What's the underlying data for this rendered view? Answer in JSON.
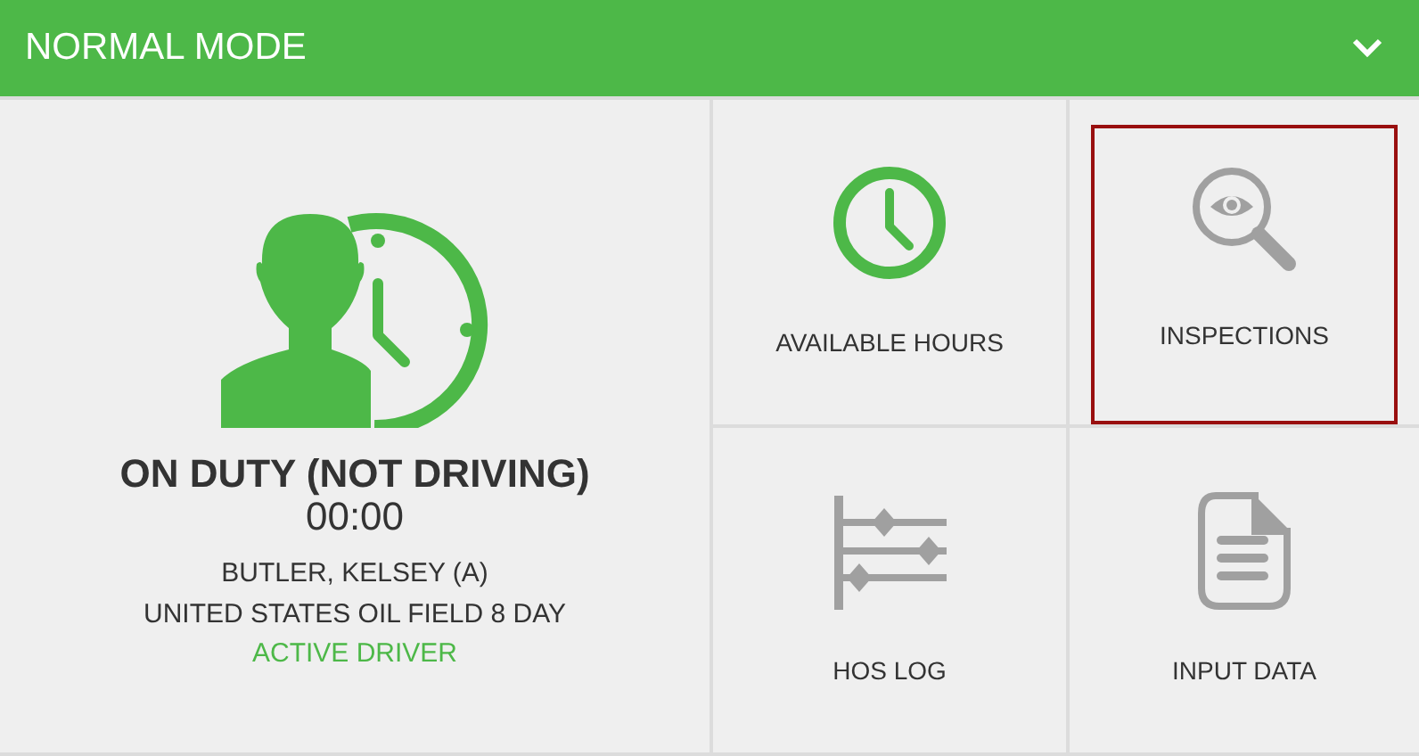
{
  "header": {
    "title": "NORMAL MODE"
  },
  "status": {
    "title": "ON DUTY (NOT DRIVING)",
    "time": "00:00",
    "driver": "BUTLER, KELSEY (A)",
    "ruleset": "UNITED STATES OIL FIELD 8 DAY",
    "role": "ACTIVE DRIVER"
  },
  "tiles": [
    {
      "kind": "hours",
      "label": "AVAILABLE HOURS",
      "selected": false
    },
    {
      "kind": "inspections",
      "label": "INSPECTIONS",
      "selected": true
    },
    {
      "kind": "log",
      "label": "HOS LOG",
      "selected": false
    },
    {
      "kind": "input",
      "label": "INPUT DATA",
      "selected": false
    }
  ]
}
